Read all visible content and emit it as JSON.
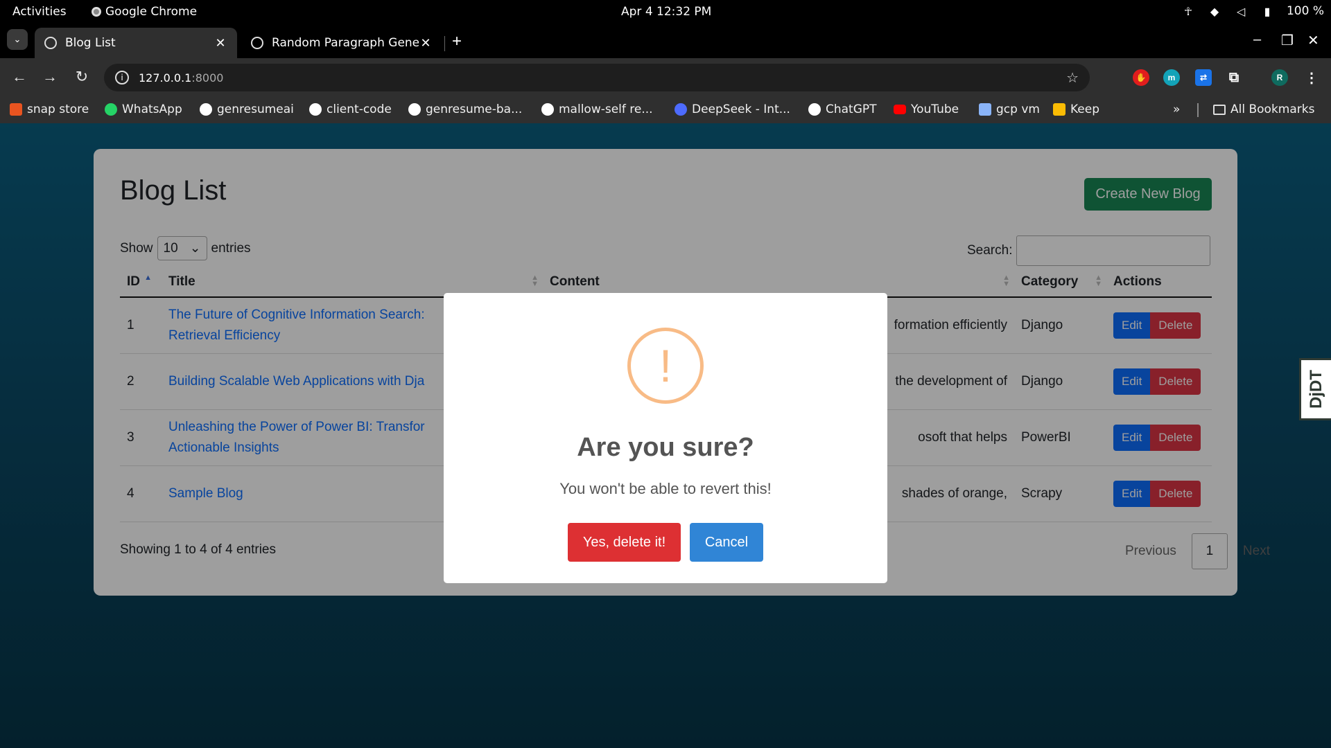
{
  "system": {
    "activities": "Activities",
    "app_name": "Google Chrome",
    "clock": "Apr 4  12:32 PM",
    "battery": "100 %"
  },
  "tabs": [
    {
      "title": "Blog List",
      "active": true
    },
    {
      "title": "Random Paragraph Gene",
      "active": false
    }
  ],
  "omnibox": {
    "host": "127.0.0.1",
    "port": ":8000"
  },
  "bookmarks": [
    {
      "label": "snap store",
      "color": "#e95420"
    },
    {
      "label": "WhatsApp",
      "color": "#25d366"
    },
    {
      "label": "genresumeai",
      "color": "#ffffff"
    },
    {
      "label": "client-code",
      "color": "#ffffff"
    },
    {
      "label": "genresume-ba...",
      "color": "#ffffff"
    },
    {
      "label": "mallow-self re...",
      "color": "#ffffff"
    },
    {
      "label": "DeepSeek - Int...",
      "color": "#4d6bfe"
    },
    {
      "label": "ChatGPT",
      "color": "#ffffff"
    },
    {
      "label": "YouTube",
      "color": "#ff0000"
    },
    {
      "label": "gcp vm",
      "color": "#8ab4f8"
    },
    {
      "label": "Keep",
      "color": "#fbbc04"
    }
  ],
  "bookmarks_more": "»",
  "all_bookmarks": "All Bookmarks",
  "page": {
    "title": "Blog List",
    "create_button": "Create New Blog",
    "show_label": "Show",
    "entries_value": "10",
    "entries_label": "entries",
    "search_label": "Search:",
    "columns": [
      "ID",
      "Title",
      "Content",
      "Category",
      "Actions"
    ],
    "rows": [
      {
        "id": "1",
        "title_line1": "The Future of Cognitive Information Search:",
        "title_line2": "Retrieval Efficiency",
        "content": "formation efficiently",
        "category": "Django"
      },
      {
        "id": "2",
        "title_line1": "Building Scalable Web Applications with Dja",
        "title_line2": "",
        "content": "the development of",
        "category": "Django"
      },
      {
        "id": "3",
        "title_line1": "Unleashing the Power of Power BI: Transfor",
        "title_line2": "Actionable Insights",
        "content": "osoft that helps",
        "category": "PowerBI"
      },
      {
        "id": "4",
        "title_line1": "Sample Blog",
        "title_line2": "",
        "content": "shades of orange,",
        "category": "Scrapy"
      }
    ],
    "edit_label": "Edit",
    "delete_label": "Delete",
    "info": "Showing 1 to 4 of 4 entries",
    "pager": {
      "previous": "Previous",
      "current": "1",
      "next": "Next"
    }
  },
  "modal": {
    "icon": "!",
    "title": "Are you sure?",
    "text": "You won't be able to revert this!",
    "confirm": "Yes, delete it!",
    "cancel": "Cancel"
  },
  "djdt": "DjDT",
  "colors": {
    "accent_green": "#198754",
    "accent_blue": "#0d6efd",
    "danger": "#dc3545",
    "warning": "#f8bb86"
  }
}
